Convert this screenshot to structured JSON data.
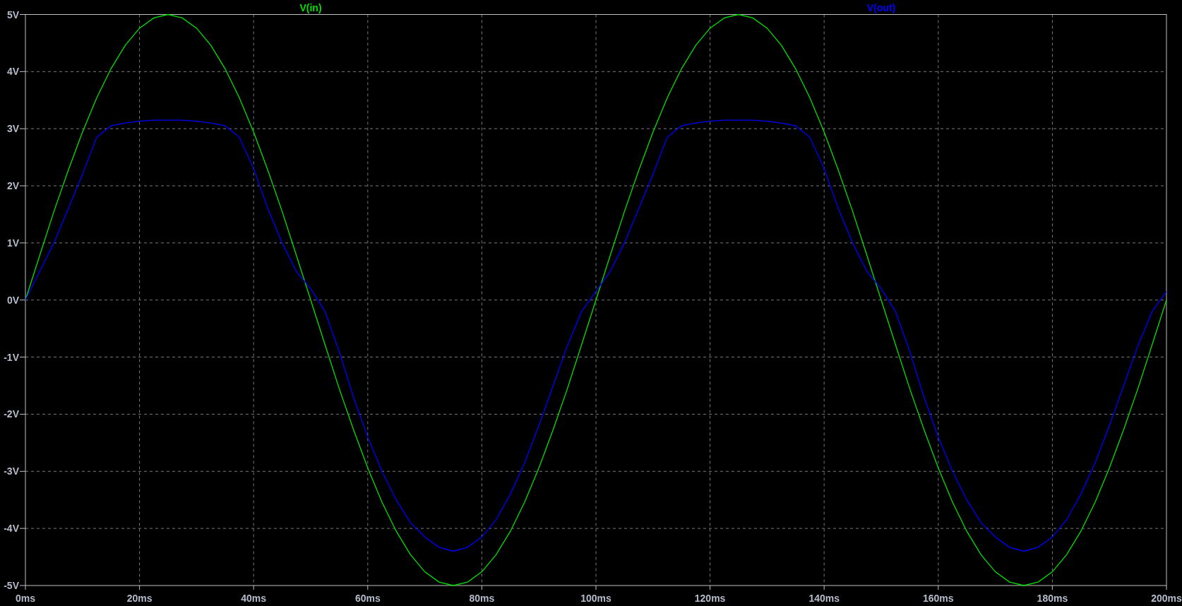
{
  "plot": {
    "chart_data": {
      "type": "line",
      "x": [
        0,
        2.5,
        5,
        7.5,
        10,
        12.5,
        15,
        17.5,
        20,
        22.5,
        25,
        27.5,
        30,
        32.5,
        35,
        37.5,
        40,
        42.5,
        45,
        47.5,
        50,
        52.5,
        55,
        57.5,
        60,
        62.5,
        65,
        67.5,
        70,
        72.5,
        75,
        77.5,
        80,
        82.5,
        85,
        87.5,
        90,
        92.5,
        95,
        97.5,
        100,
        102.5,
        105,
        107.5,
        110,
        112.5,
        115,
        117.5,
        120,
        122.5,
        125,
        127.5,
        130,
        132.5,
        135,
        137.5,
        140,
        142.5,
        145,
        147.5,
        150,
        152.5,
        155,
        157.5,
        160,
        162.5,
        165,
        167.5,
        170,
        172.5,
        175,
        177.5,
        180,
        182.5,
        185,
        187.5,
        190,
        192.5,
        195,
        197.5,
        200
      ],
      "series": [
        {
          "name": "V(in)",
          "color": "#00e000",
          "values": [
            0,
            0.78,
            1.55,
            2.27,
            2.94,
            3.54,
            4.05,
            4.46,
            4.76,
            4.94,
            5,
            4.94,
            4.76,
            4.46,
            4.05,
            3.54,
            2.94,
            2.27,
            1.55,
            0.78,
            0,
            -0.78,
            -1.55,
            -2.27,
            -2.94,
            -3.54,
            -4.05,
            -4.46,
            -4.76,
            -4.94,
            -5,
            -4.94,
            -4.76,
            -4.46,
            -4.05,
            -3.54,
            -2.94,
            -2.27,
            -1.55,
            -0.78,
            0,
            0.78,
            1.55,
            2.27,
            2.94,
            3.54,
            4.05,
            4.46,
            4.76,
            4.94,
            5,
            4.94,
            4.76,
            4.46,
            4.05,
            3.54,
            2.94,
            2.27,
            1.55,
            0.78,
            0,
            -0.78,
            -1.55,
            -2.27,
            -2.94,
            -3.54,
            -4.05,
            -4.46,
            -4.76,
            -4.94,
            -5,
            -4.94,
            -4.76,
            -4.46,
            -4.05,
            -3.54,
            -2.94,
            -2.27,
            -1.55,
            -0.78,
            0
          ]
        },
        {
          "name": "V(out)",
          "color": "#0000ff",
          "values": [
            0,
            0.5,
            1.0,
            1.6,
            2.2,
            2.85,
            3.05,
            3.1,
            3.13,
            3.15,
            3.15,
            3.15,
            3.13,
            3.1,
            3.05,
            2.85,
            2.3,
            1.6,
            1.0,
            0.5,
            0.2,
            -0.2,
            -0.9,
            -1.7,
            -2.4,
            -3.0,
            -3.5,
            -3.9,
            -4.15,
            -4.33,
            -4.4,
            -4.33,
            -4.15,
            -3.85,
            -3.4,
            -2.85,
            -2.2,
            -1.5,
            -0.8,
            -0.2,
            0.15,
            0.5,
            1.0,
            1.6,
            2.2,
            2.85,
            3.05,
            3.1,
            3.13,
            3.15,
            3.15,
            3.15,
            3.13,
            3.1,
            3.05,
            2.85,
            2.3,
            1.6,
            1.0,
            0.5,
            0.2,
            -0.2,
            -0.9,
            -1.7,
            -2.4,
            -3.0,
            -3.5,
            -3.9,
            -4.15,
            -4.33,
            -4.4,
            -4.33,
            -4.15,
            -3.85,
            -3.4,
            -2.85,
            -2.2,
            -1.5,
            -0.8,
            -0.2,
            0.15
          ]
        }
      ],
      "grid": true,
      "xlim": [
        0,
        200
      ],
      "ylim": [
        -5,
        5
      ],
      "xticks": [
        {
          "value": 0,
          "label": "0ms"
        },
        {
          "value": 20,
          "label": "20ms"
        },
        {
          "value": 40,
          "label": "40ms"
        },
        {
          "value": 60,
          "label": "60ms"
        },
        {
          "value": 80,
          "label": "80ms"
        },
        {
          "value": 100,
          "label": "100ms"
        },
        {
          "value": 120,
          "label": "120ms"
        },
        {
          "value": 140,
          "label": "140ms"
        },
        {
          "value": 160,
          "label": "160ms"
        },
        {
          "value": 180,
          "label": "180ms"
        },
        {
          "value": 200,
          "label": "200ms"
        }
      ],
      "yticks": [
        {
          "value": 5,
          "label": "5V"
        },
        {
          "value": 4,
          "label": "4V"
        },
        {
          "value": 3,
          "label": "3V"
        },
        {
          "value": 2,
          "label": "2V"
        },
        {
          "value": 1,
          "label": "1V"
        },
        {
          "value": 0,
          "label": "0V"
        },
        {
          "value": -1,
          "label": "-1V"
        },
        {
          "value": -2,
          "label": "-2V"
        },
        {
          "value": -3,
          "label": "-3V"
        },
        {
          "value": -4,
          "label": "-4V"
        },
        {
          "value": -5,
          "label": "-5V"
        }
      ]
    }
  }
}
